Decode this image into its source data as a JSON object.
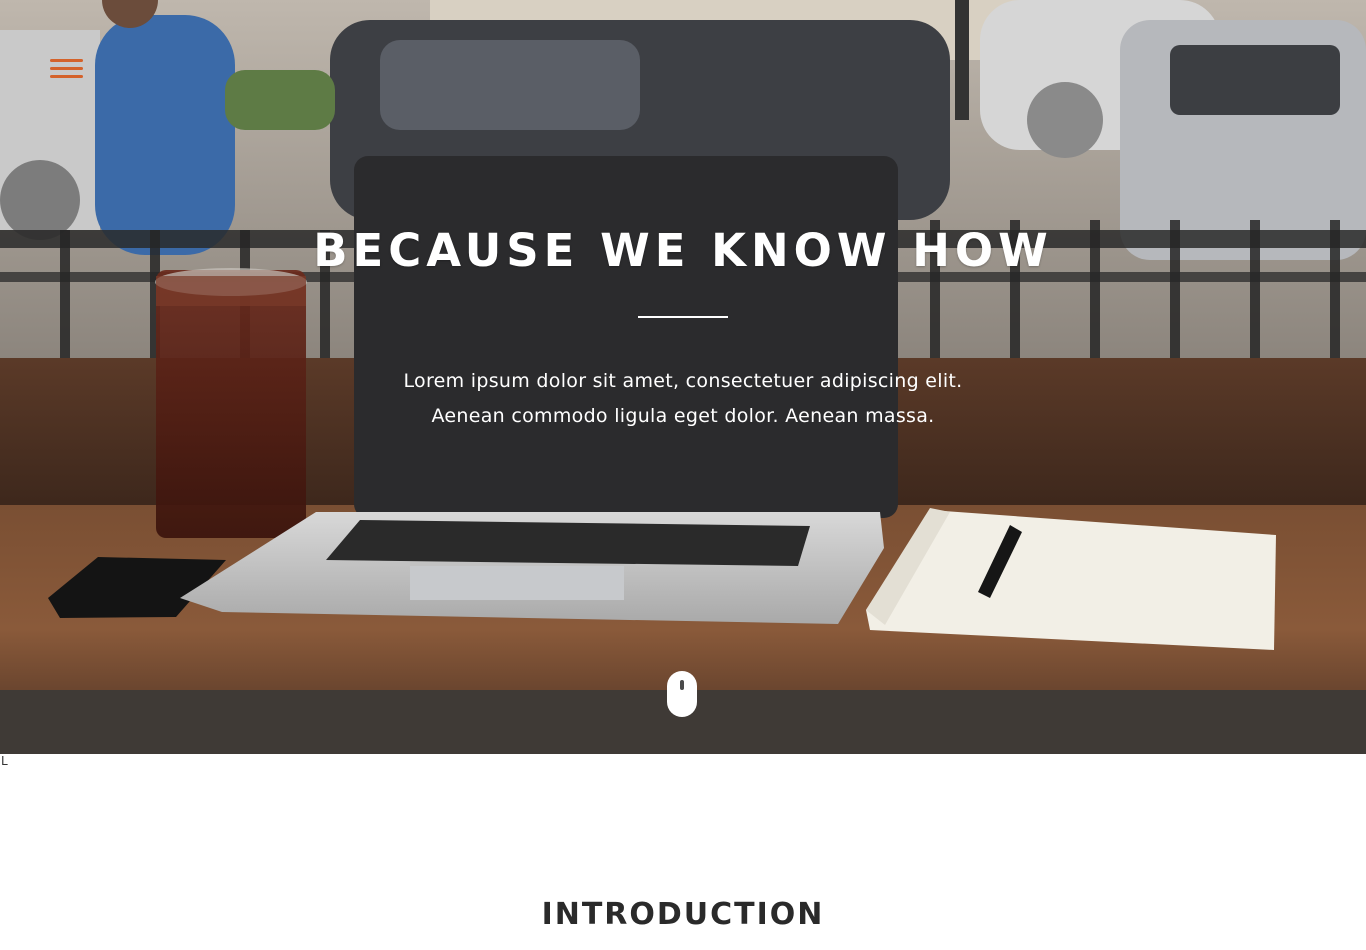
{
  "nav": {
    "menu_icon": "hamburger-menu-icon",
    "menu_color": "#d4622a"
  },
  "hero": {
    "title": "BECAUSE WE KNOW HOW",
    "text_line1": "Lorem ipsum dolor sit amet, consectetuer adipiscing elit.",
    "text_line2": "Aenean commodo ligula eget dolor. Aenean massa.",
    "scroll_icon": "scroll-mouse-icon",
    "background_image": "laptop, iced drink, phone and notebook on a wooden cafe table"
  },
  "stray_text": "L",
  "intro": {
    "title": "INTRODUCTION"
  }
}
